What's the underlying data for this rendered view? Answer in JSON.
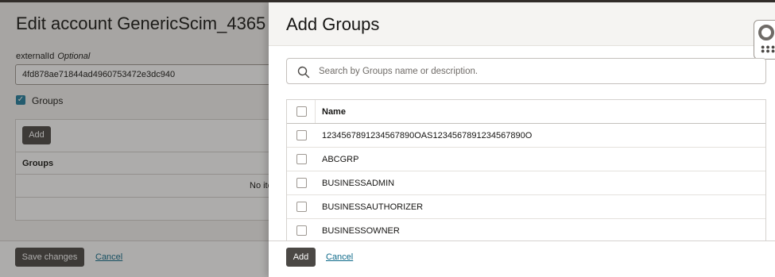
{
  "background": {
    "title": "Edit account GenericScim_4365",
    "external_id_label": "externalId",
    "external_id_optional": "Optional",
    "external_id_value": "4fd878ae71844ad4960753472e3dc940",
    "groups_checkbox_label": "Groups",
    "groups_checked": true,
    "add_button": "Add",
    "groups_column": "Groups",
    "no_items_text": "No ite",
    "save_button": "Save changes",
    "cancel_link": "Cancel"
  },
  "drawer": {
    "title": "Add Groups",
    "search": {
      "placeholder": "Search by Groups name or description.",
      "value": "",
      "icon": "search-icon"
    },
    "table": {
      "column_name": "Name",
      "rows": [
        "1234567891234567890OAS1234567891234567890O",
        "ABCGRP",
        "BUSINESSADMIN",
        "BUSINESSAUTHORIZER",
        "BUSINESSOWNER"
      ]
    },
    "add_button": "Add",
    "cancel_link": "Cancel"
  },
  "colors": {
    "accent": "#227e9e",
    "primary_button": "#4b4845",
    "link": "#0e6a8a",
    "header_bg": "#f5f4f2"
  }
}
